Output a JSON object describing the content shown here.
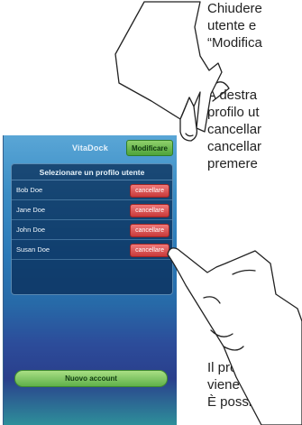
{
  "phone": {
    "title": "VitaDock",
    "modify_label": "Modificare",
    "panel_title": "Selezionare un profilo utente",
    "profiles": [
      {
        "name": "Bob Doe",
        "delete_label": "cancellare"
      },
      {
        "name": "Jane Doe",
        "delete_label": "cancellare"
      },
      {
        "name": "John Doe",
        "delete_label": "cancellare"
      },
      {
        "name": "Susan Doe",
        "delete_label": "cancellare"
      }
    ],
    "new_account_label": "Nuovo account"
  },
  "instructions": {
    "para1": "Chiudere\nutente e\n“Modifica",
    "para2": "A destra\nprofilo ut\ncancellar\ncancellar\npremere",
    "para3": "Il profilo\nviene vis\nÈ possib"
  },
  "colors": {
    "accent_green": "#5fb04a",
    "delete_red": "#c83a3a",
    "background_blue": "#2a78b7"
  }
}
